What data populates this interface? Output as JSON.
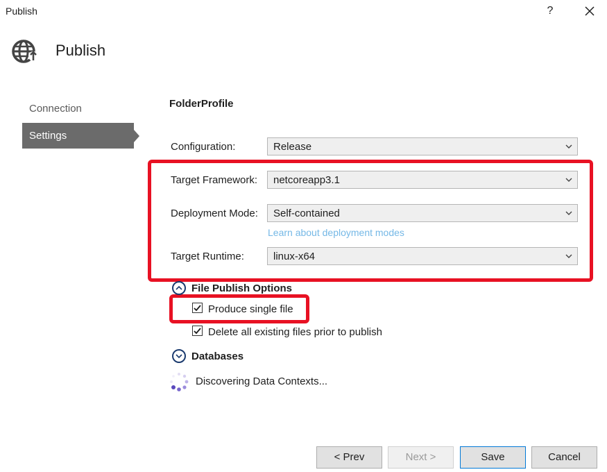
{
  "window": {
    "title": "Publish",
    "help_label": "?"
  },
  "header": {
    "title": "Publish"
  },
  "sidebar": {
    "items": [
      {
        "label": "Connection"
      },
      {
        "label": "Settings"
      }
    ]
  },
  "profile": {
    "name": "FolderProfile"
  },
  "fields": {
    "configuration": {
      "label": "Configuration:",
      "value": "Release"
    },
    "target_framework": {
      "label": "Target Framework:",
      "value": "netcoreapp3.1"
    },
    "deployment_mode": {
      "label": "Deployment Mode:",
      "value": "Self-contained"
    },
    "deployment_link": "Learn about deployment modes",
    "target_runtime": {
      "label": "Target Runtime:",
      "value": "linux-x64"
    }
  },
  "file_publish": {
    "title": "File Publish Options",
    "options": [
      {
        "label": "Produce single file",
        "checked": true
      },
      {
        "label": "Delete all existing files prior to publish",
        "checked": true
      }
    ]
  },
  "databases": {
    "title": "Databases",
    "status": "Discovering Data Contexts..."
  },
  "buttons": {
    "prev": "< Prev",
    "next": "Next >",
    "save": "Save",
    "cancel": "Cancel"
  },
  "colors": {
    "highlight": "#e81123",
    "selected_nav": "#6b6b6b",
    "link": "#75b8e6",
    "primary_border": "#0078d7"
  }
}
